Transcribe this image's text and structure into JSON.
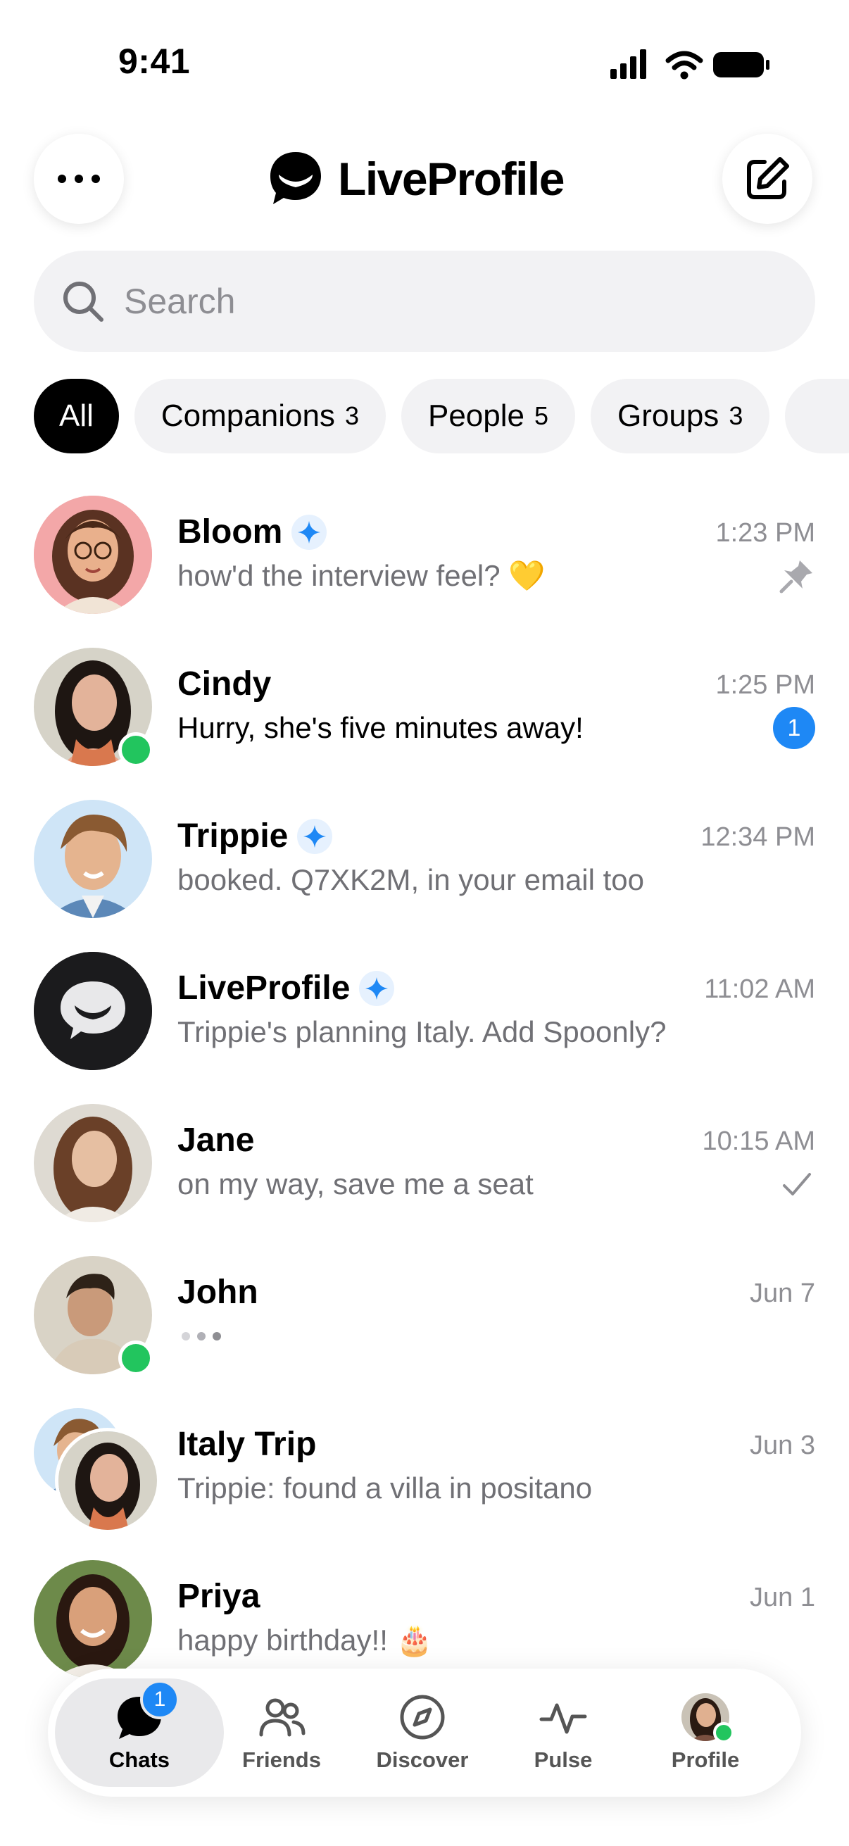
{
  "status_bar": {
    "time": "9:41"
  },
  "header": {
    "brand": "LiveProfile"
  },
  "search": {
    "placeholder": "Search"
  },
  "filters": [
    {
      "label": "All",
      "count": ""
    },
    {
      "label": "Companions",
      "count": "3"
    },
    {
      "label": "People",
      "count": "5"
    },
    {
      "label": "Groups",
      "count": "3"
    }
  ],
  "chats": [
    {
      "name": "Bloom",
      "preview": "how'd the interview feel? 💛",
      "time": "1:23 PM",
      "status": "pinned"
    },
    {
      "name": "Cindy",
      "preview": "Hurry, she's five minutes away!",
      "time": "1:25 PM",
      "unread": "1"
    },
    {
      "name": "Trippie",
      "preview": "booked. Q7XK2M, in your email too",
      "time": "12:34 PM"
    },
    {
      "name": "LiveProfile",
      "preview": "Trippie's planning Italy. Add Spoonly?",
      "time": "11:02 AM"
    },
    {
      "name": "Jane",
      "preview": "on my way, save me a seat",
      "time": "10:15 AM",
      "status": "sent"
    },
    {
      "name": "John",
      "preview": "",
      "time": "Jun 7",
      "status": "typing"
    },
    {
      "name": "Italy Trip",
      "preview": "Trippie: found a villa in positano",
      "time": "Jun 3"
    },
    {
      "name": "Priya",
      "preview": "happy birthday!! 🎂",
      "time": "Jun 1"
    }
  ],
  "tabbar": {
    "tabs": [
      {
        "label": "Chats",
        "badge": "1"
      },
      {
        "label": "Friends"
      },
      {
        "label": "Discover"
      },
      {
        "label": "Pulse"
      },
      {
        "label": "Profile"
      }
    ]
  },
  "colors": {
    "accent": "#1e88f5",
    "online": "#22c55e",
    "chip_bg": "#f2f2f4"
  }
}
